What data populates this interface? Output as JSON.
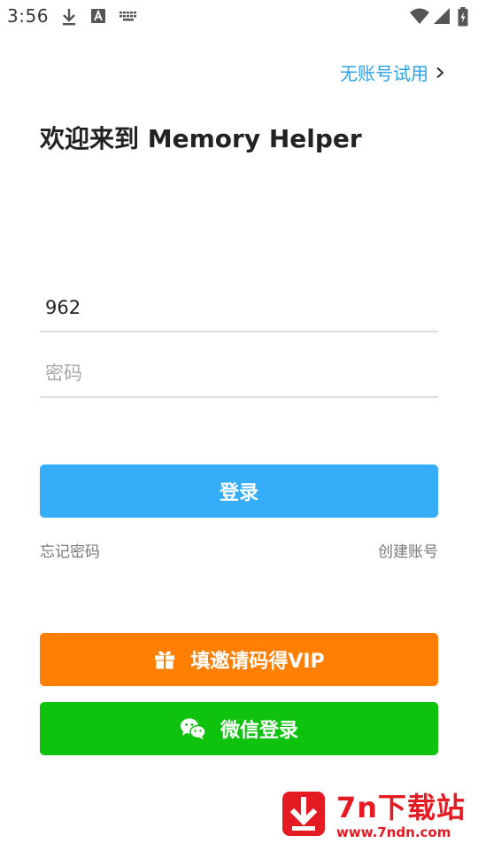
{
  "status_bar": {
    "time": "3:56",
    "icons": [
      "download-icon",
      "a-icon",
      "keyboard-icon",
      "wifi-icon",
      "signal-icon",
      "battery-icon"
    ]
  },
  "trial_link": {
    "label": "无账号试用"
  },
  "welcome": {
    "title": "欢迎来到 Memory Helper"
  },
  "form": {
    "username": {
      "value": "962",
      "placeholder": ""
    },
    "password": {
      "value": "",
      "placeholder": "密码"
    },
    "login_label": "登录",
    "forgot_label": "忘记密码",
    "create_label": "创建账号"
  },
  "actions": {
    "invite_label": "填邀请码得VIP",
    "wechat_label": "微信登录"
  },
  "watermark": {
    "title": "7n下载站",
    "url": "www.7ndn.com"
  },
  "colors": {
    "accent_blue": "#36adf8",
    "link_blue": "#2ba2e6",
    "invite_orange": "#fe7f02",
    "wechat_green": "#0ec20e",
    "watermark_red": "#e41b23"
  }
}
